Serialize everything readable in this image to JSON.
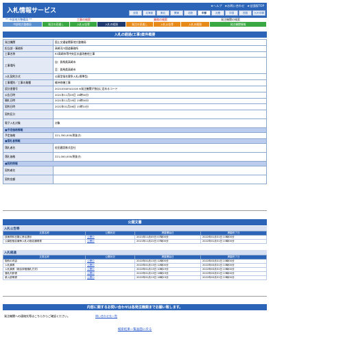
{
  "header": {
    "brand": "入札情報サービス",
    "toplinks": [
      "★ヘルプ",
      "★お問い合わせ",
      "★全国版TOP"
    ],
    "regions": [
      "全国",
      "北海道",
      "東北",
      "関東",
      "北陸",
      "中部",
      "近畿",
      "中国",
      "四国",
      "九州沖縄"
    ]
  },
  "subheader": {
    "left": "** 中部地方整備局 **",
    "mid_left": "工事の検索",
    "mid": "業務の検索",
    "right": "発注機関の検索"
  },
  "tabs": [
    "中部地方整備局",
    "発注の見通し",
    "入札公告等",
    "入札の経過",
    "発注の見通し",
    "入札公告等",
    "入札の経過",
    "発注機関情報"
  ],
  "detail": {
    "title": "入札の経過(工事)案件概要",
    "rows": [
      {
        "label": "発注機関",
        "value": "国土交通省関東地方整備局"
      },
      {
        "label": "担当部・事務所",
        "value": "高崎河川国道事務所"
      },
      {
        "label": "工事名称",
        "value": "R3高崎市等中央区水道改善他工事"
      },
      {
        "label": "工事場所",
        "value": "自：群馬県高崎市\n至：群馬県高崎市"
      },
      {
        "label": "入札契約方式",
        "value": "公募型指名競争入札(標準型)"
      },
      {
        "label": "工事種別／工事の業種",
        "value": "維持修繕工事"
      },
      {
        "label": "設計書番号",
        "value": "20210340541016        ※発注機関が独自に定めるコード"
      },
      {
        "label": "公告日時",
        "value": "2021年11月05日 16時00分"
      },
      {
        "label": "開札日時",
        "value": "2021年11月19日 15時00分"
      },
      {
        "label": "契約日時",
        "value": "2022年01月06日 15時10分"
      },
      {
        "label": "契約区分",
        "value": ""
      },
      {
        "label": "電子入札対象",
        "value": "対象"
      }
    ],
    "group_estimate": "■予定価格情報",
    "estimate": {
      "label": "予定価格",
      "value": "221,350,000(税抜き)"
    },
    "group_contract": "■落札者情報",
    "winner": {
      "label": "落札者名",
      "value": "佐田建設株式会社"
    },
    "winner_price": {
      "label": "落札価格",
      "value": "221,000,000(税抜き)"
    },
    "group_contract2": "■契約情報",
    "contractor": {
      "label": "契約者名",
      "value": ""
    },
    "contract_amount": {
      "label": "契約金額",
      "value": ""
    }
  },
  "documents": {
    "title": "公開文書",
    "sections": [
      {
        "name": "入札公告等",
        "columns": [
          "文書名称",
          "公開状況",
          "掲載開始日",
          "掲載終了日"
        ],
        "rows": [
          [
            "技術資料日数に係る提示",
            "公開中",
            "2021年11月05日 07時00分",
            "2022年01月31日 23時00分"
          ],
          [
            "公募型指名競争入札の指名通常書",
            "公開中",
            "2021年11月22日 07時00分",
            "2022年01月31日 23時00分"
          ]
        ]
      },
      {
        "name": "入札経過",
        "columns": [
          "文書名称",
          "公開状況",
          "掲載開始日",
          "掲載終了日"
        ],
        "rows": [
          [
            "契約の内容",
            "公開中",
            "2022年01月13日 12時00分",
            "2022年03月31日 23時00分"
          ],
          [
            "入札調書",
            "公開中",
            "2022年01月13日 12時00分",
            "2022年03月31日 23時00分"
          ],
          [
            "入札調書（総合評価落札方式）",
            "公開中",
            "2022年01月13日 10時19分",
            "2022年03月31日 23時00分"
          ],
          [
            "落札内訳書",
            "公開中",
            "2022年01月13日 16時19分",
            "2022年03月31日 23時00分"
          ],
          [
            "参入説明書",
            "公開中",
            "2022年01月13日 16時19分",
            "2022年03月31日 23時00分"
          ]
        ]
      }
    ]
  },
  "contact": {
    "title": "内容に関するお問い合わせは各発注機関までお願い致します。",
    "label": "発注機関への連絡先等はこちらからご確認ください。",
    "link": "問い合わせ先一覧"
  },
  "back_link": "検索結果一覧画面に戻る",
  "colors": {
    "brand": "#2c65b8",
    "label_bg": "#e3e9f5",
    "group_bg": "#bcccee",
    "link": "#2255cc"
  }
}
